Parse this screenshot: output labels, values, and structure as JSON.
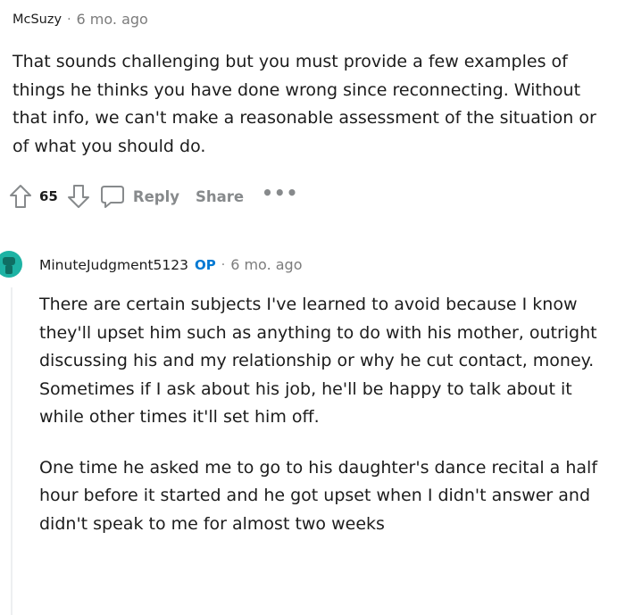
{
  "comment": {
    "author": "McSuzy",
    "separator": "·",
    "time": "6 mo. ago",
    "body": "That sounds challenging but you must provide a few examples of things he thinks you have done wrong since reconnecting. Without that info, we can't make a reasonable assessment of the situation or of what you should do.",
    "vote_count": "65",
    "reply_label": "Reply",
    "share_label": "Share",
    "more_label": "•••"
  },
  "reply": {
    "author": "MinuteJudgment5123",
    "op_badge": "OP",
    "separator": "·",
    "time": "6 mo. ago",
    "paragraphs": [
      "There are certain subjects I've learned to avoid because I know they'll upset him such as anything to do with his mother, outright discussing his and my relationship or why he cut contact, money. Sometimes if I ask about his job, he'll be happy to talk about it while other times it'll set him off.",
      "One time he asked me to go to his daughter's dance recital a half hour before it started and he got upset when I didn't answer and didn't speak to me for almost two weeks"
    ]
  },
  "colors": {
    "text": "#1c1c1c",
    "meta": "#7c7c7c",
    "action": "#878a8c",
    "op_badge": "#0079d3",
    "avatar": "#1db3a4",
    "thread_line": "#edeff1"
  },
  "icons": [
    "upvote-icon",
    "downvote-icon",
    "comment-icon",
    "avatar-icon"
  ]
}
